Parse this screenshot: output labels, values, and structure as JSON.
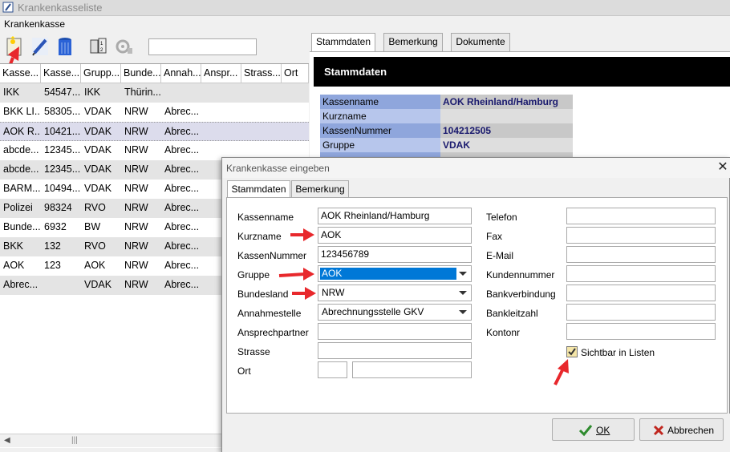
{
  "window": {
    "title": "Krankenkasseliste",
    "menu": "Krankenkasse"
  },
  "toolbar": {
    "search_value": ""
  },
  "grid": {
    "headers": [
      "Kasse...",
      "Kasse...",
      "Grupp...",
      "Bunde...",
      "Annah...",
      "Anspr...",
      "Strass...",
      "Ort"
    ],
    "rows": [
      [
        "IKK",
        "54547...",
        "IKK",
        "Thürin...",
        "",
        "",
        "",
        ""
      ],
      [
        "BKK LI...",
        "58305...",
        "VDAK",
        "NRW",
        "Abrec...",
        "",
        "",
        ""
      ],
      [
        "AOK R...",
        "10421...",
        "VDAK",
        "NRW",
        "Abrec...",
        "",
        "",
        ""
      ],
      [
        "abcde...",
        "12345...",
        "VDAK",
        "NRW",
        "Abrec...",
        "",
        "",
        ""
      ],
      [
        "abcde...",
        "12345...",
        "VDAK",
        "NRW",
        "Abrec...",
        "",
        "",
        ""
      ],
      [
        "BARM...",
        "10494...",
        "VDAK",
        "NRW",
        "Abrec...",
        "",
        "",
        ""
      ],
      [
        "Polizei",
        "98324",
        "RVO",
        "NRW",
        "Abrec...",
        "",
        "",
        ""
      ],
      [
        "Bunde...",
        "6932",
        "BW",
        "NRW",
        "Abrec...",
        "",
        "",
        ""
      ],
      [
        "BKK",
        "132",
        "RVO",
        "NRW",
        "Abrec...",
        "",
        "",
        ""
      ],
      [
        "AOK",
        "123",
        "AOK",
        "NRW",
        "Abrec...",
        "",
        "",
        ""
      ],
      [
        "Abrec...",
        "",
        "VDAK",
        "NRW",
        "Abrec...",
        "",
        "",
        ""
      ]
    ]
  },
  "right_panel": {
    "tabs": [
      "Stammdaten",
      "Bemerkung",
      "Dokumente"
    ],
    "header": "Stammdaten",
    "fields": [
      {
        "label": "Kassenname",
        "value": "AOK Rheinland/Hamburg"
      },
      {
        "label": "Kurzname",
        "value": ""
      },
      {
        "label": "KassenNummer",
        "value": "104212505"
      },
      {
        "label": "Gruppe",
        "value": "VDAK"
      }
    ]
  },
  "dialog": {
    "title": "Krankenkasse eingeben",
    "close": "✕",
    "tabs": [
      "Stammdaten",
      "Bemerkung"
    ],
    "left_fields": {
      "kassenname": {
        "label": "Kassenname",
        "value": "AOK Rheinland/Hamburg"
      },
      "kurzname": {
        "label": "Kurzname",
        "value": "AOK"
      },
      "kassennummer": {
        "label": "KassenNummer",
        "value": "123456789"
      },
      "gruppe": {
        "label": "Gruppe",
        "value": "AOK"
      },
      "bundesland": {
        "label": "Bundesland",
        "value": "NRW"
      },
      "annahmestelle": {
        "label": "Annahmestelle",
        "value": "Abrechnungsstelle GKV"
      },
      "ansprechpartner": {
        "label": "Ansprechpartner",
        "value": ""
      },
      "strasse": {
        "label": "Strasse",
        "value": ""
      },
      "ort": {
        "label": "Ort",
        "plz": "",
        "value": ""
      }
    },
    "right_fields": {
      "telefon": {
        "label": "Telefon",
        "value": ""
      },
      "fax": {
        "label": "Fax",
        "value": ""
      },
      "email": {
        "label": "E-Mail",
        "value": ""
      },
      "kundennummer": {
        "label": "Kundennummer",
        "value": ""
      },
      "bankverbindung": {
        "label": "Bankverbindung",
        "value": ""
      },
      "bankleitzahl": {
        "label": "Bankleitzahl",
        "value": ""
      },
      "kontonr": {
        "label": "Kontonr",
        "value": ""
      }
    },
    "checkbox": {
      "label": "Sichtbar in Listen",
      "checked": true
    },
    "buttons": {
      "ok": "OK",
      "cancel": "Abbrechen"
    }
  },
  "colors": {
    "annotation_arrow": "#e8282c",
    "selection": "#0078d7",
    "header_black": "#000000"
  }
}
